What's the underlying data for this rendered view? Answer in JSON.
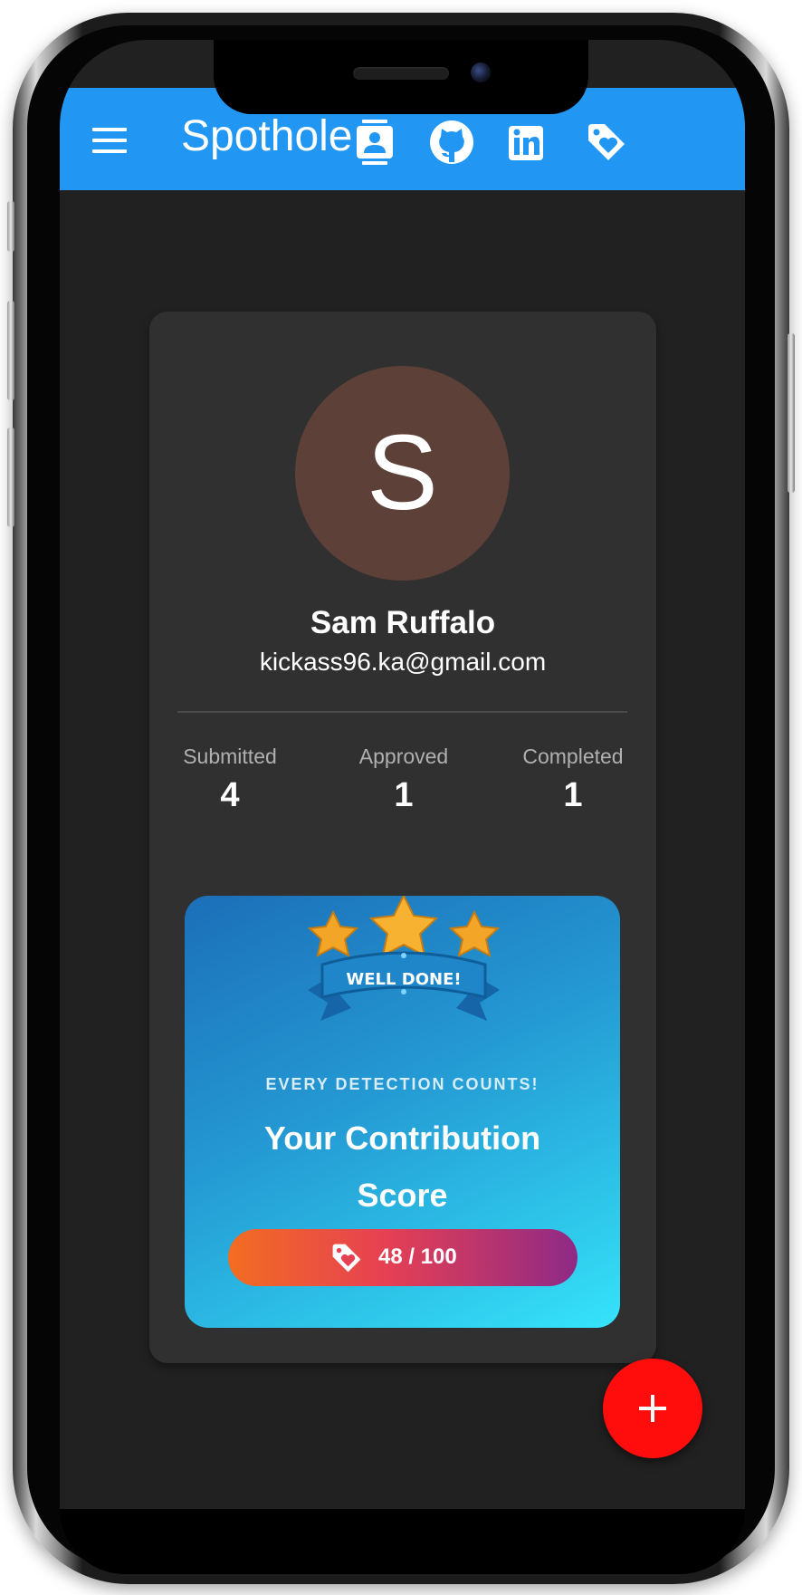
{
  "app": {
    "title": "Spothole",
    "theme_color": "#2196f3",
    "icons": [
      "menu-icon",
      "contacts-icon",
      "github-icon",
      "linkedin-icon",
      "tag-heart-icon"
    ]
  },
  "profile": {
    "avatar_initial": "S",
    "avatar_color": "#5d4037",
    "name": "Sam Ruffalo",
    "email": "kickass96.ka@gmail.com"
  },
  "stats": [
    {
      "label": "Submitted",
      "value": "4"
    },
    {
      "label": "Approved",
      "value": "1"
    },
    {
      "label": "Completed",
      "value": "1"
    }
  ],
  "score": {
    "badge_text": "WELL DONE!",
    "eyebrow": "EVERY DETECTION COUNTS!",
    "title": "Your Contribution Score",
    "value_text": "48 / 100",
    "value": 48,
    "max": 100
  },
  "fab": {
    "icon": "plus-icon",
    "color": "#ff0d0d"
  }
}
